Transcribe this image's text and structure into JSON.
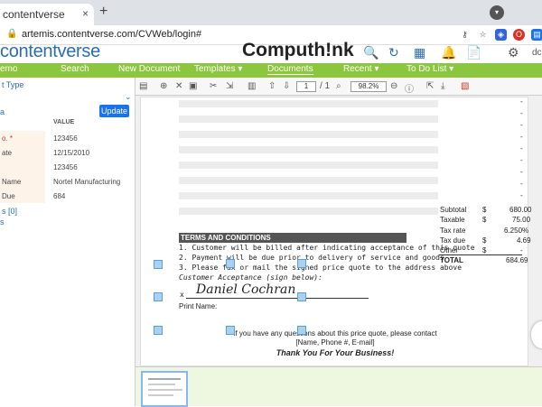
{
  "browser": {
    "tab_title": "contentverse",
    "new_tab": "+",
    "close_tab": "×",
    "url": "artemis.contentverse.com/CVWeb/login#"
  },
  "app": {
    "logo_left": "contentverse",
    "logo_right": "Computh!nk",
    "user_short": "dc"
  },
  "nav": {
    "items": [
      {
        "label": "emo"
      },
      {
        "label": "Search"
      },
      {
        "label": "New Document"
      },
      {
        "label": "Templates ▾"
      },
      {
        "label": "Documents"
      },
      {
        "label": "Recent ▾"
      },
      {
        "label": "To Do List ▾"
      }
    ]
  },
  "left_panel": {
    "link_top": "t Type",
    "link_a": "a",
    "update_label": "Update",
    "value_header": "VALUE",
    "rows": [
      {
        "key": "o. *",
        "value": "123456",
        "required": true
      },
      {
        "key": "ate",
        "value": "12/15/2010",
        "required": false
      },
      {
        "key": "",
        "value": "123456",
        "required": false
      },
      {
        "key": "Name",
        "value": "Nortel Manufacturing",
        "required": false
      },
      {
        "key": "Due",
        "value": "684",
        "required": false
      }
    ],
    "link_bottom": "s [0]",
    "link_last": "s"
  },
  "viewer": {
    "page_number": "1",
    "page_total": "/ 1",
    "zoom": "98.2%",
    "terms_heading": "TERMS AND CONDITIONS",
    "terms": [
      "1. Customer will be billed after indicating acceptance of this quote",
      "2. Payment will be due prior to delivery of service and goods",
      "3. Please fax or mail the signed price quote to the address above"
    ],
    "acceptance_label": "Customer Acceptance (sign below):",
    "signature_x": "x",
    "signature": "Daniel Cochran",
    "print_name": "Print Name:",
    "questions": "If you have any questions about this price quote, please contact",
    "contact": "[Name, Phone #, E-mail]",
    "thanks": "Thank You For Your Business!",
    "totals": [
      {
        "label": "Subtotal",
        "currency": "$",
        "value": "680.00"
      },
      {
        "label": "Taxable",
        "currency": "$",
        "value": "75.00"
      },
      {
        "label": "Tax rate",
        "currency": "",
        "value": "6.250%"
      },
      {
        "label": "Tax due",
        "currency": "$",
        "value": "4.69"
      },
      {
        "label": "Other",
        "currency": "$",
        "value": "-"
      }
    ],
    "total_label": "TOTAL",
    "total_value": "684.69",
    "dash": "-"
  }
}
